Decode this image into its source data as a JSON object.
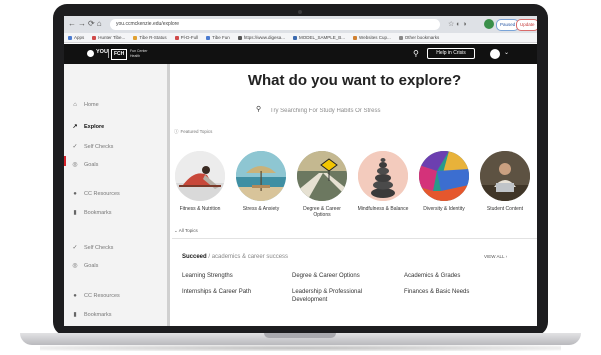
{
  "browser": {
    "url": "you.ccmckenzie.edu/explore",
    "bookmarks": [
      "Apps",
      "Hunter Tibe...",
      "Tibe R-Status",
      "Pl-D-Full",
      "Tibe Fun",
      "https://www.digesa...",
      "MODEL_SAMPLE_B...",
      "Websites Cup...",
      "Other bookmarks"
    ],
    "pills": {
      "blue": "Paused",
      "red": "Update"
    }
  },
  "header": {
    "logo_text": "YOU",
    "logo_box": "FCH",
    "logo_sub": "Fun Center Health",
    "help_button": "Help in Crisis"
  },
  "sidebar": {
    "items": [
      {
        "label": "Home",
        "icon": "home-icon"
      },
      {
        "label": "Explore",
        "icon": "explore-icon",
        "active": true
      },
      {
        "label": "Self Checks",
        "icon": "check-icon"
      },
      {
        "label": "Goals",
        "icon": "goals-icon"
      },
      {
        "label": "CC Resources",
        "icon": "pin-icon"
      },
      {
        "label": "Bookmarks",
        "icon": "bookmark-icon"
      },
      {
        "label": "Self Checks",
        "icon": "check-icon"
      },
      {
        "label": "Goals",
        "icon": "goals-icon"
      },
      {
        "label": "CC Resources",
        "icon": "pin-icon"
      },
      {
        "label": "Bookmarks",
        "icon": "bookmark-icon"
      }
    ]
  },
  "main": {
    "title": "What do you want to explore?",
    "search_placeholder": "Try Searching For Study Habits Or Stress",
    "featured_label": "Featured Topics",
    "topics": [
      {
        "label": "Fitness & Nutrition",
        "image": "yoga-person",
        "color": "#e8e8e8"
      },
      {
        "label": "Stress & Anxiety",
        "image": "beach-umbrella",
        "color": "#6bb1c2"
      },
      {
        "label": "Degree & Career Options",
        "image": "diverging-road",
        "color": "#7d8b78"
      },
      {
        "label": "Mindfulness & Balance",
        "image": "stacked-stones",
        "color": "#f1c6b7"
      },
      {
        "label": "Diversity & Identity",
        "image": "colorful-art",
        "color": "#c53a6b"
      },
      {
        "label": "Student Content",
        "image": "student-laptop",
        "color": "#5b5141"
      }
    ],
    "all_topics_label": "All Topics",
    "section": {
      "title": "Succeed",
      "subtitle": "/  academics & career success",
      "view_all": "VIEW ALL"
    },
    "links": [
      "Learning Strengths",
      "Degree & Career Options",
      "Academics & Grades",
      "Internships & Career Path",
      "Leadership & Professional Development",
      "Finances & Basic Needs"
    ]
  }
}
